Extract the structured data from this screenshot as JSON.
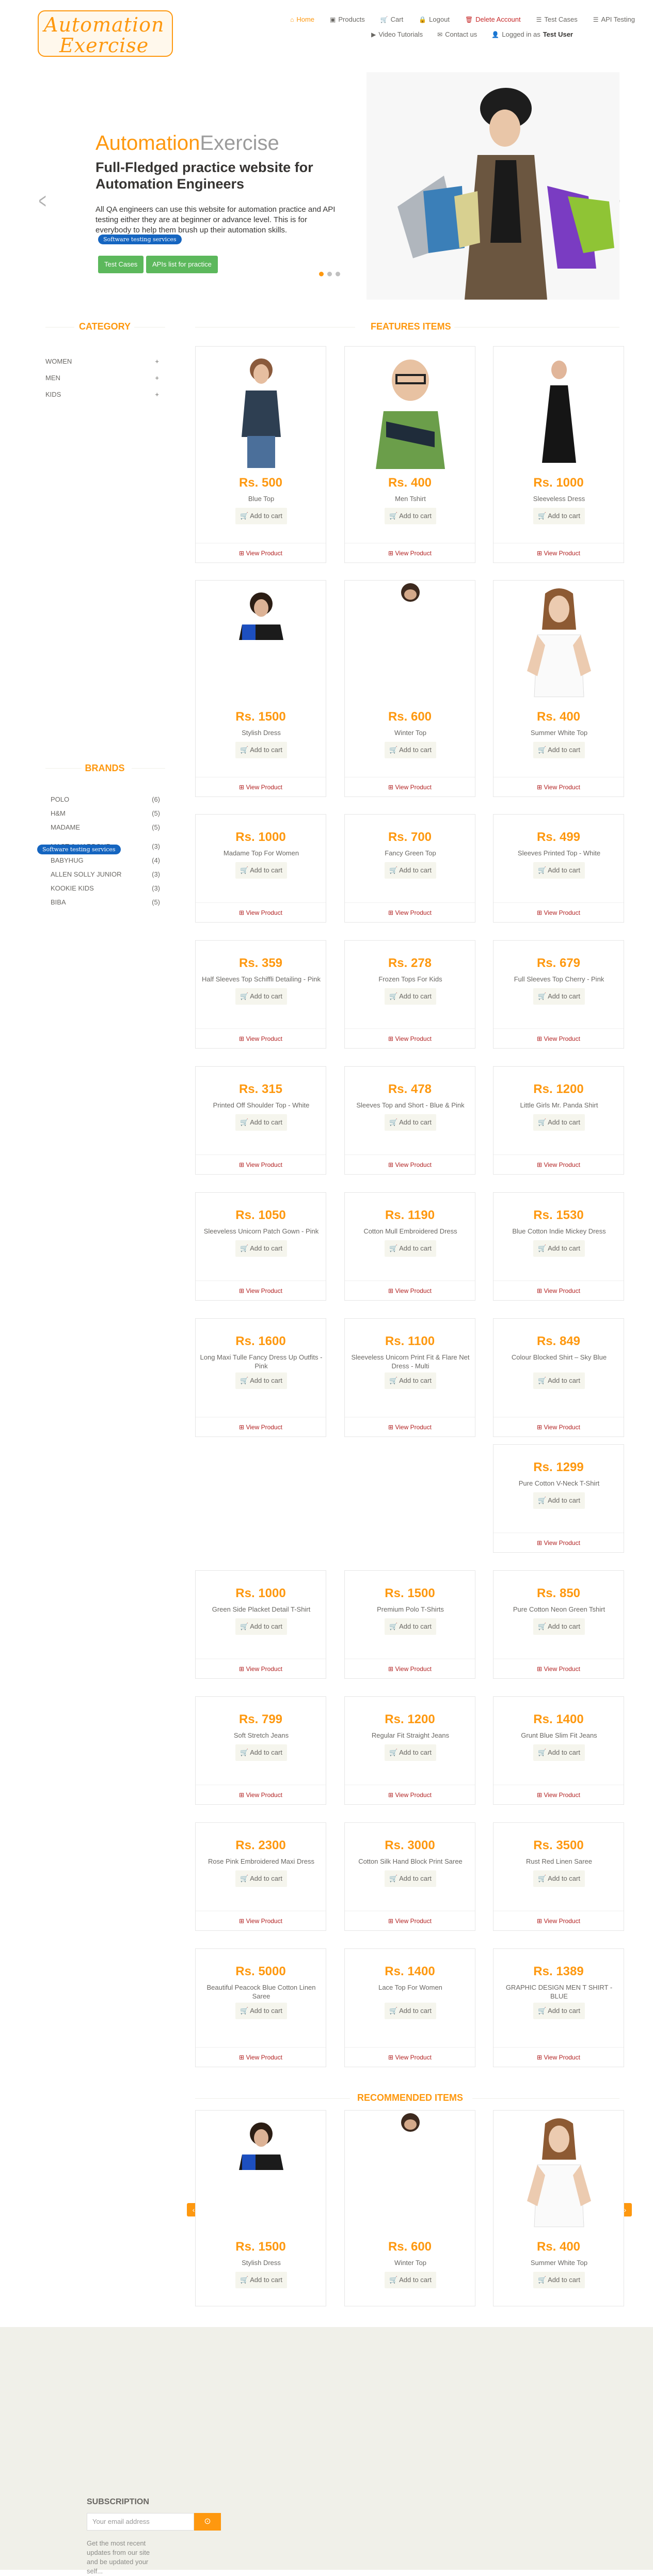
{
  "logo": {
    "line1a": "Automation",
    "line2a": "Exercise"
  },
  "nav": [
    {
      "label": "Home",
      "icon": "home-icon",
      "glyph": "⌂"
    },
    {
      "label": "Products",
      "icon": "products-icon",
      "glyph": "▣"
    },
    {
      "label": "Cart",
      "icon": "cart-icon",
      "glyph": "🛒"
    },
    {
      "label": "Logout",
      "icon": "lock-icon",
      "glyph": "🔒"
    },
    {
      "label": "Delete Account",
      "icon": "trash-icon",
      "glyph": "🗑"
    },
    {
      "label": "Test Cases",
      "icon": "list-icon",
      "glyph": "☰"
    },
    {
      "label": "API Testing",
      "icon": "list-icon",
      "glyph": "☰"
    }
  ],
  "nav2": [
    {
      "label": "Video Tutorials",
      "icon": "youtube-icon",
      "glyph": "▶"
    },
    {
      "label": "Contact us",
      "icon": "envelope-icon",
      "glyph": "✉"
    },
    {
      "label": "Logged in as",
      "user": "Test User",
      "icon": "user-icon",
      "glyph": "👤"
    }
  ],
  "slider": {
    "title1": "Automation",
    "title2": "Exercise",
    "heading": "Full-Fledged practice website for Automation Engineers",
    "text": "All QA engineers can use this website for automation practice and API testing either they are at beginner or advance level. This is for everybody to help them brush up their automation skills.",
    "ad_badge": "Software testing services",
    "btn_test_cases": "Test Cases",
    "btn_apis": "APIs list for practice"
  },
  "category": {
    "title": "CATEGORY",
    "items": [
      "WOMEN",
      "MEN",
      "KIDS"
    ]
  },
  "brands": {
    "title": "BRANDS",
    "items": [
      {
        "name": "POLO",
        "count": "(6)"
      },
      {
        "name": "H&M",
        "count": "(5)"
      },
      {
        "name": "MADAME",
        "count": "(5)"
      },
      {
        "name": "MAST & HARBOUR",
        "count": "(3)"
      },
      {
        "name": "BABYHUG",
        "count": "(4)"
      },
      {
        "name": "ALLEN SOLLY JUNIOR",
        "count": "(3)"
      },
      {
        "name": "KOOKIE KIDS",
        "count": "(3)"
      },
      {
        "name": "BIBA",
        "count": "(5)"
      }
    ],
    "ad_badge": "Software testing services"
  },
  "features_title": "FEATURES ITEMS",
  "card_labels": {
    "add": "Add to cart",
    "view": "View Product"
  },
  "products": [
    {
      "price": "Rs. 500",
      "name": "Blue Top"
    },
    {
      "price": "Rs. 400",
      "name": "Men Tshirt"
    },
    {
      "price": "Rs. 1000",
      "name": "Sleeveless Dress"
    },
    {
      "price": "Rs. 1500",
      "name": "Stylish Dress"
    },
    {
      "price": "Rs. 600",
      "name": "Winter Top"
    },
    {
      "price": "Rs. 400",
      "name": "Summer White Top"
    },
    {
      "price": "Rs. 1000",
      "name": "Madame Top For Women"
    },
    {
      "price": "Rs. 700",
      "name": "Fancy Green Top"
    },
    {
      "price": "Rs. 499",
      "name": "Sleeves Printed Top - White"
    },
    {
      "price": "Rs. 359",
      "name": "Half Sleeves Top Schiffli Detailing - Pink"
    },
    {
      "price": "Rs. 278",
      "name": "Frozen Tops For Kids"
    },
    {
      "price": "Rs. 679",
      "name": "Full Sleeves Top Cherry - Pink"
    },
    {
      "price": "Rs. 315",
      "name": "Printed Off Shoulder Top - White"
    },
    {
      "price": "Rs. 478",
      "name": "Sleeves Top and Short - Blue & Pink"
    },
    {
      "price": "Rs. 1200",
      "name": "Little Girls Mr. Panda Shirt"
    },
    {
      "price": "Rs. 1050",
      "name": "Sleeveless Unicorn Patch Gown - Pink"
    },
    {
      "price": "Rs. 1190",
      "name": "Cotton Mull Embroidered Dress"
    },
    {
      "price": "Rs. 1530",
      "name": "Blue Cotton Indie Mickey Dress"
    },
    {
      "price": "Rs. 1600",
      "name": "Long Maxi Tulle Fancy Dress Up Outfits -Pink"
    },
    {
      "price": "Rs. 1100",
      "name": "Sleeveless Unicorn Print Fit & Flare Net Dress - Multi"
    },
    {
      "price": "Rs. 849",
      "name": "Colour Blocked Shirt – Sky Blue"
    },
    {
      "price": "Rs. 1299",
      "name": "Pure Cotton V-Neck T-Shirt"
    },
    {
      "price": "Rs. 1000",
      "name": "Green Side Placket Detail T-Shirt"
    },
    {
      "price": "Rs. 1500",
      "name": "Premium Polo T-Shirts"
    },
    {
      "price": "Rs. 850",
      "name": "Pure Cotton Neon Green Tshirt"
    },
    {
      "price": "Rs. 799",
      "name": "Soft Stretch Jeans"
    },
    {
      "price": "Rs. 1200",
      "name": "Regular Fit Straight Jeans"
    },
    {
      "price": "Rs. 1400",
      "name": "Grunt Blue Slim Fit Jeans"
    },
    {
      "price": "Rs. 2300",
      "name": "Rose Pink Embroidered Maxi Dress"
    },
    {
      "price": "Rs. 3000",
      "name": "Cotton Silk Hand Block Print Saree"
    },
    {
      "price": "Rs. 3500",
      "name": "Rust Red Linen Saree"
    },
    {
      "price": "Rs. 5000",
      "name": "Beautiful Peacock Blue Cotton Linen Saree"
    },
    {
      "price": "Rs. 1400",
      "name": "Lace Top For Women"
    },
    {
      "price": "Rs. 1389",
      "name": "GRAPHIC DESIGN MEN T SHIRT - BLUE"
    }
  ],
  "recommended": {
    "title": "RECOMMENDED ITEMS",
    "items": [
      {
        "price": "Rs. 1500",
        "name": "Stylish Dress"
      },
      {
        "price": "Rs. 600",
        "name": "Winter Top"
      },
      {
        "price": "Rs. 400",
        "name": "Summer White Top"
      }
    ]
  },
  "footer": {
    "subscription": "SUBSCRIPTION",
    "placeholder": "Your email address",
    "note": "Get the most recent updates from our site and be updated your self..."
  },
  "colors": {
    "accent": "#fe980f",
    "green": "#5cb85c",
    "danger": "#b22222",
    "ad_blue": "#1565c0"
  }
}
